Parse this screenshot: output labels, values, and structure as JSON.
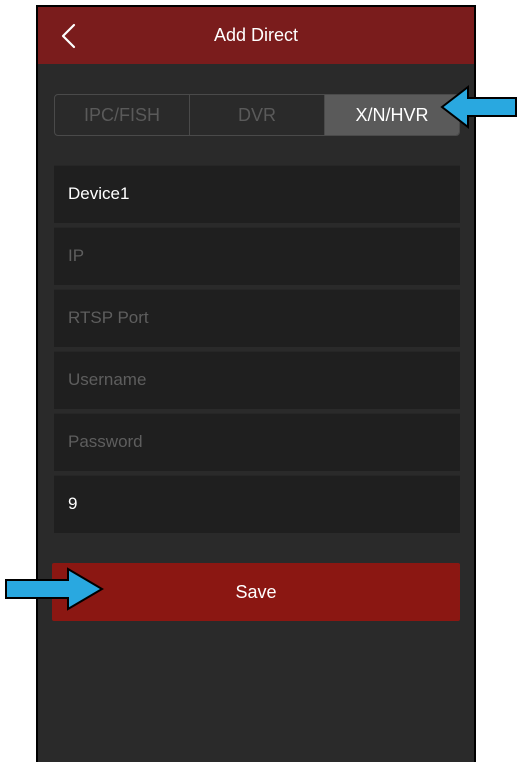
{
  "header": {
    "title": "Add Direct",
    "back_icon": "chevron-left-icon"
  },
  "tabs": [
    {
      "label": "IPC/FISH",
      "active": false
    },
    {
      "label": "DVR",
      "active": false
    },
    {
      "label": "X/N/HVR",
      "active": true
    }
  ],
  "fields": [
    {
      "name": "device-name-field",
      "value": "Device1",
      "placeholder": ""
    },
    {
      "name": "ip-field",
      "value": "",
      "placeholder": "IP"
    },
    {
      "name": "rtsp-port-field",
      "value": "",
      "placeholder": "RTSP Port"
    },
    {
      "name": "username-field",
      "value": "",
      "placeholder": "Username"
    },
    {
      "name": "password-field",
      "value": "",
      "placeholder": "Password"
    },
    {
      "name": "channel-count-field",
      "value": "9",
      "placeholder": ""
    }
  ],
  "save_label": "Save",
  "colors": {
    "header": "#7a1c1c",
    "background": "#2a2a2a",
    "field": "#1f1f1f",
    "save_button": "#8b1712",
    "annotation_arrow": "#29a8e0"
  },
  "annotations": [
    {
      "icon": "left-arrow-icon",
      "points_to": "X/N/HVR"
    },
    {
      "icon": "right-arrow-icon",
      "points_to": "Save"
    }
  ]
}
